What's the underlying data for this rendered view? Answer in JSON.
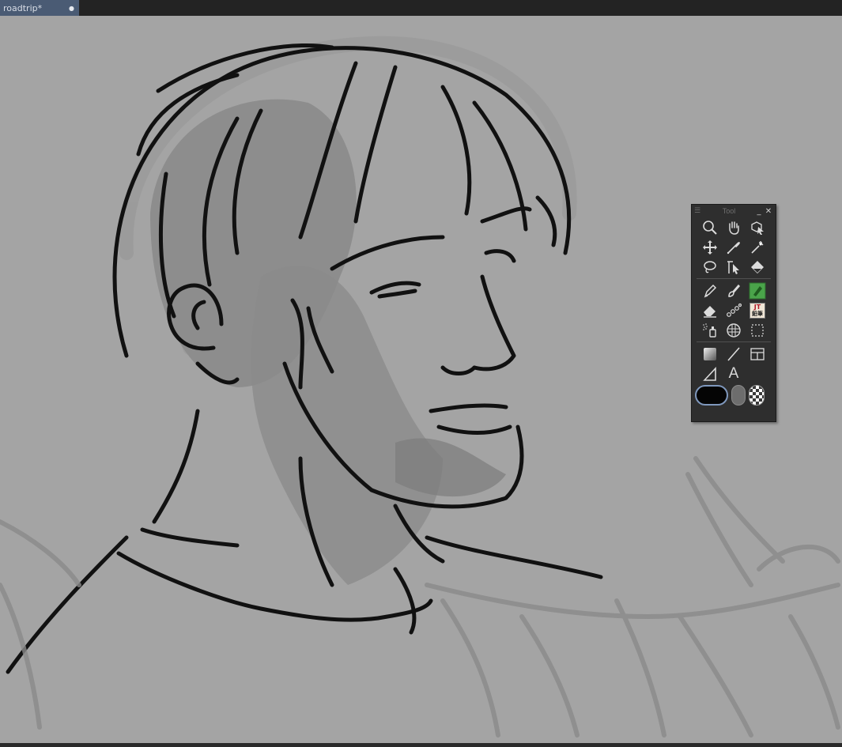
{
  "document_tab": {
    "title": "roadtrip*",
    "close_glyph": "●"
  },
  "tool_panel": {
    "title": "Tool",
    "menu_glyph": "☰",
    "minimize_glyph": "_",
    "close_glyph": "✕",
    "tools": [
      {
        "name": "zoom",
        "icon": "magnifier-icon"
      },
      {
        "name": "hand",
        "icon": "hand-icon"
      },
      {
        "name": "operation",
        "icon": "operation-cursor-icon"
      },
      {
        "name": "move-layer",
        "icon": "move-icon"
      },
      {
        "name": "eyedropper",
        "icon": "eyedropper-icon"
      },
      {
        "name": "auto-select",
        "icon": "magic-wand-icon"
      },
      {
        "name": "lasso",
        "icon": "lasso-icon"
      },
      {
        "name": "selection-pen",
        "icon": "selection-arrow-icon"
      },
      {
        "name": "fill",
        "icon": "fill-bucket-icon"
      },
      {
        "name": "pen",
        "icon": "pen-icon"
      },
      {
        "name": "brush",
        "icon": "brush-icon"
      },
      {
        "name": "marker",
        "icon": "marker-icon"
      },
      {
        "name": "eraser",
        "icon": "eraser-icon"
      },
      {
        "name": "decoration",
        "icon": "decoration-icon"
      },
      {
        "name": "pencil-jt",
        "icon": "jt-pencil-icon",
        "label_top": "JT",
        "label_bottom": "鉛筆"
      },
      {
        "name": "airbrush",
        "icon": "airbrush-icon"
      },
      {
        "name": "blend",
        "icon": "blend-icon"
      },
      {
        "name": "rect-select",
        "icon": "rect-select-icon"
      },
      {
        "name": "gradient",
        "icon": "gradient-icon"
      },
      {
        "name": "figure",
        "icon": "line-icon"
      },
      {
        "name": "frame",
        "icon": "frame-icon"
      },
      {
        "name": "ruler",
        "icon": "ruler-icon"
      },
      {
        "name": "text",
        "icon": "text-icon",
        "glyph": "A"
      }
    ],
    "colors": {
      "main": "#050505",
      "sub": "#6d6d6d"
    }
  }
}
